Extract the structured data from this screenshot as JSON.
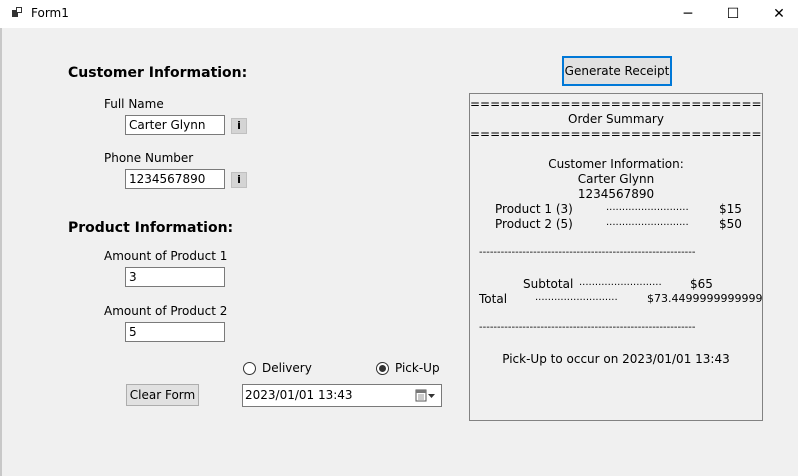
{
  "window": {
    "title": "Form1",
    "minimize_glyph": "─",
    "maximize_glyph": "☐",
    "close_glyph": "✕"
  },
  "customer": {
    "heading": "Customer Information:",
    "full_name_label": "Full Name",
    "full_name_value": "Carter Glynn",
    "phone_label": "Phone Number",
    "phone_value": "1234567890",
    "info_glyph": "i"
  },
  "product": {
    "heading": "Product Information:",
    "amount1_label": "Amount of Product 1",
    "amount1_value": "3",
    "amount2_label": "Amount of Product 2",
    "amount2_value": "5"
  },
  "fulfillment": {
    "delivery_label": "Delivery",
    "pickup_label": "Pick-Up",
    "selected": "pickup",
    "datetime_value": "2023/01/01 13:43"
  },
  "buttons": {
    "clear_form": "Clear Form",
    "generate_receipt": "Generate Receipt"
  },
  "receipt": {
    "separator_equals": "================================",
    "title": "Order Summary",
    "customer_heading": "Customer Information:",
    "customer_name": "Carter Glynn",
    "customer_phone": "1234567890",
    "product1_label": "Product 1 (3)",
    "product1_dots": "..........................",
    "product1_price": "$15",
    "product2_label": "Product 2 (5)",
    "product2_dots": "..........................",
    "product2_price": "$50",
    "separator_dashes": "------------------------------------------------------------",
    "subtotal_label": "Subtotal",
    "subtotal_dots": "..........................",
    "subtotal_value": "$65",
    "total_label": "Total",
    "total_dots": "..........................",
    "total_value": "$73.44999999999999",
    "pickup_message": "Pick-Up to occur on 2023/01/01 13:43"
  },
  "colors": {
    "focus_border": "#0078d7",
    "form_background": "#f0f0f0"
  }
}
